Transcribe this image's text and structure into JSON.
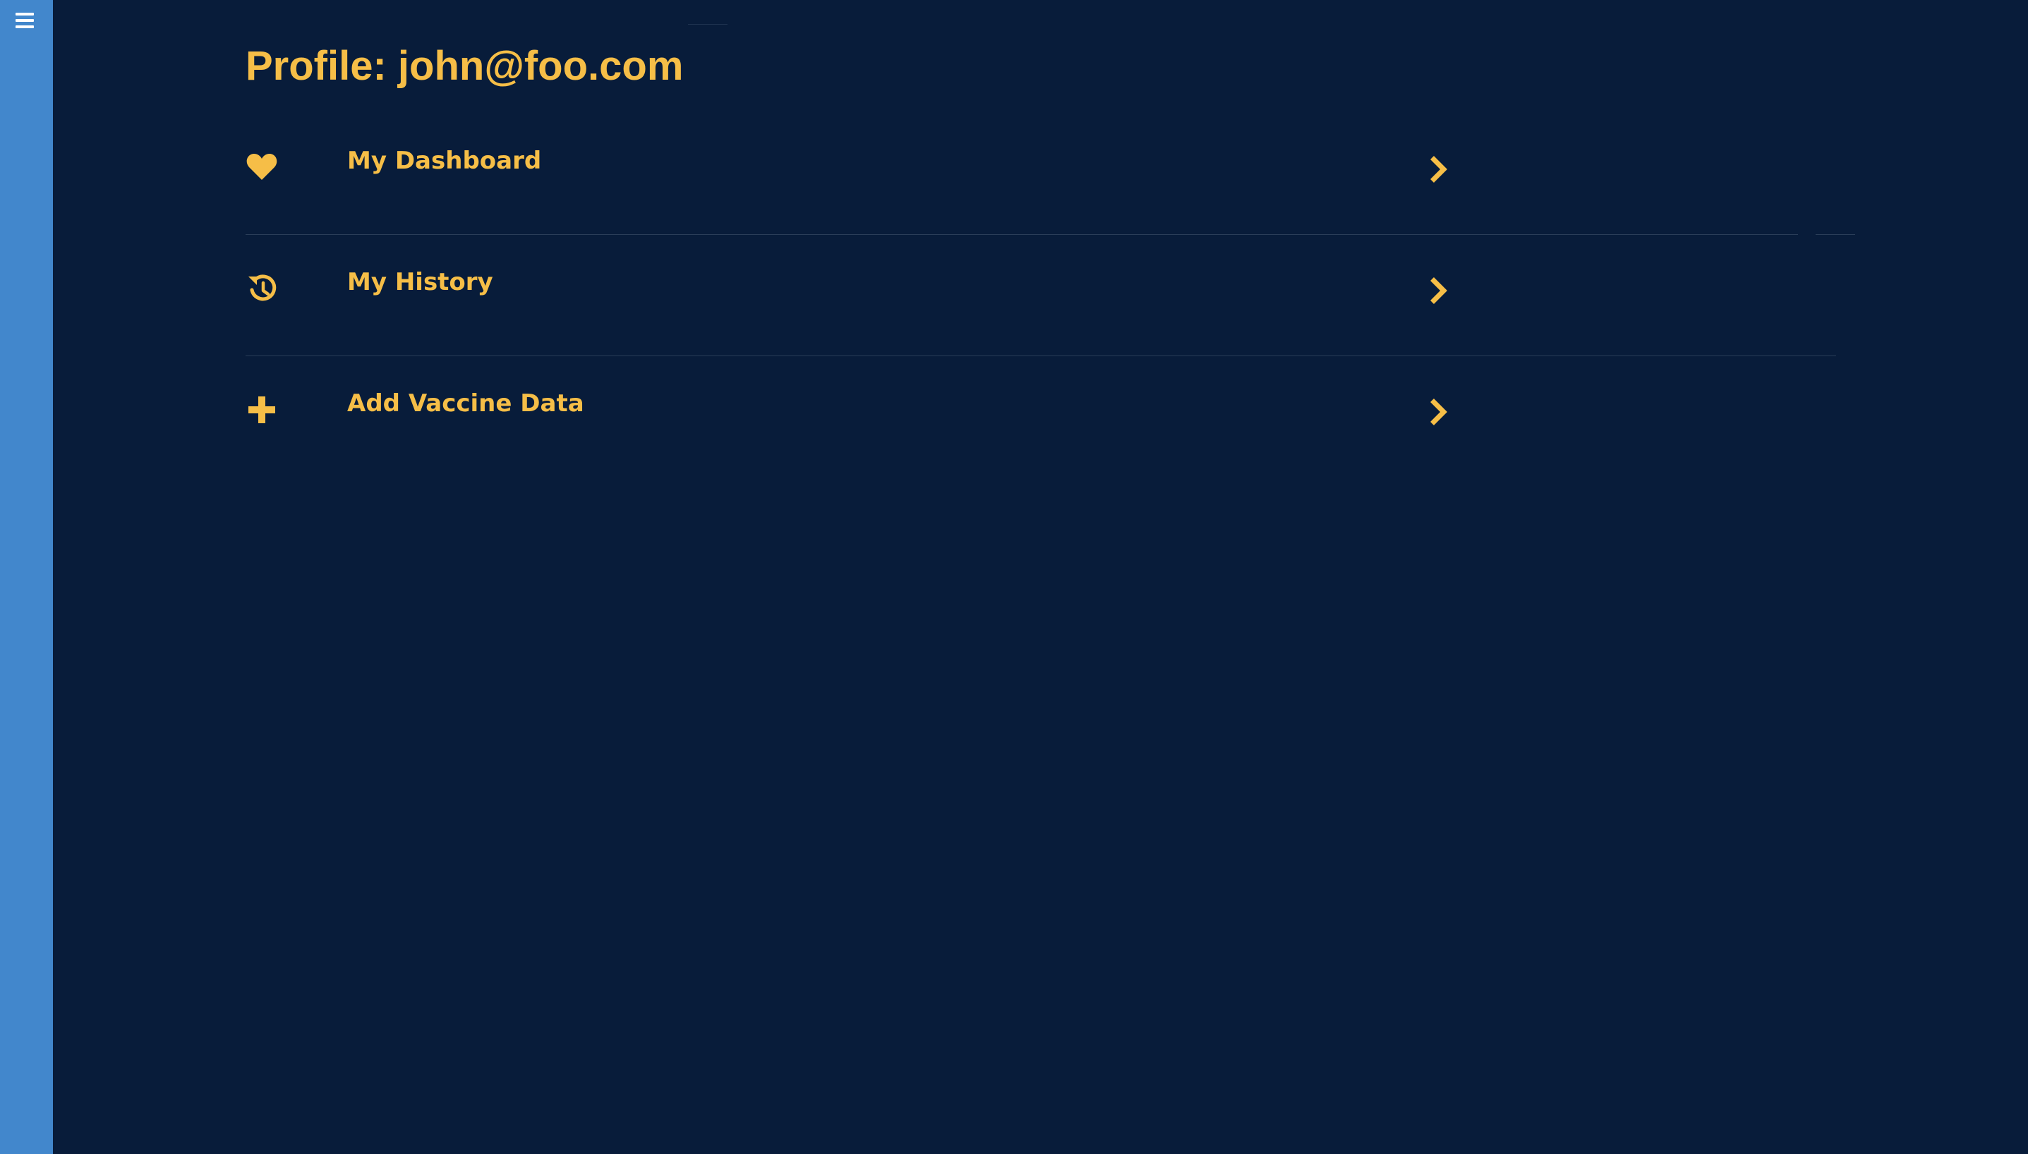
{
  "header": {
    "title": "Profile: john@foo.com"
  },
  "sidebar": {
    "menu_icon": "hamburger-menu-icon"
  },
  "menu": {
    "items": [
      {
        "label": "My Dashboard",
        "icon": "heart-icon"
      },
      {
        "label": "My History",
        "icon": "history-icon"
      },
      {
        "label": "Add Vaccine Data",
        "icon": "plus-icon"
      }
    ],
    "chevron_icon": "chevron-right-icon"
  },
  "colors": {
    "background": "#081c3a",
    "sidebar": "#4287cc",
    "accent": "#f6be47"
  }
}
